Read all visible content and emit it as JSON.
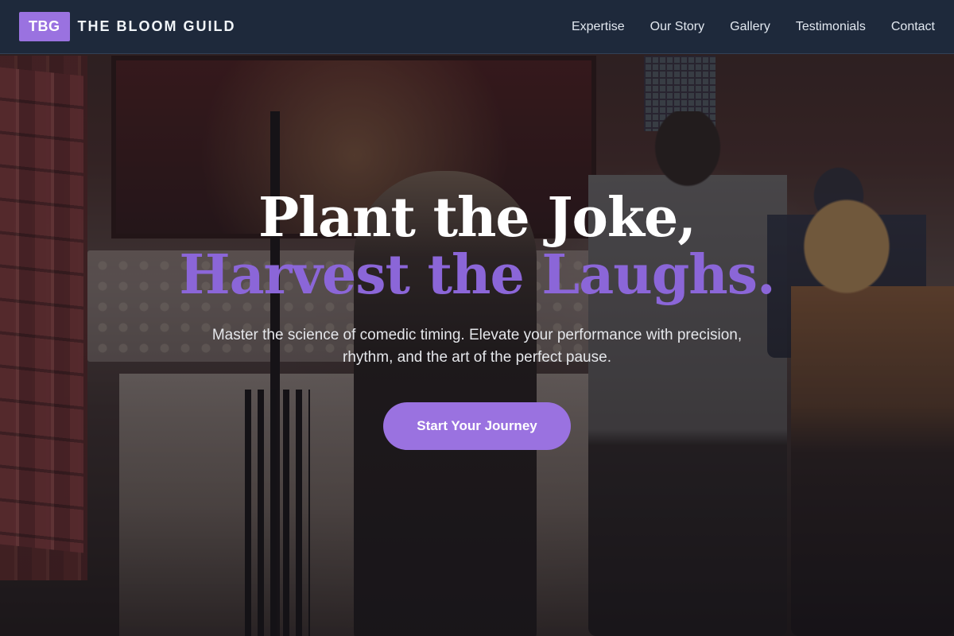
{
  "nav": {
    "logo_badge": "TBG",
    "brand_name": "THE BLOOM GUILD",
    "links": [
      "Expertise",
      "Our Story",
      "Gallery",
      "Testimonials",
      "Contact"
    ]
  },
  "hero": {
    "headline_line1": "Plant the Joke,",
    "headline_line2": "Harvest the Laughs.",
    "subtitle": "Master the science of comedic timing. Elevate your performance with precision, rhythm, and the art of the perfect pause.",
    "cta_label": "Start Your Journey"
  },
  "colors": {
    "accent": "#9a72e0",
    "headline_accent": "#8b66d8",
    "nav_bg": "#1e293b"
  }
}
